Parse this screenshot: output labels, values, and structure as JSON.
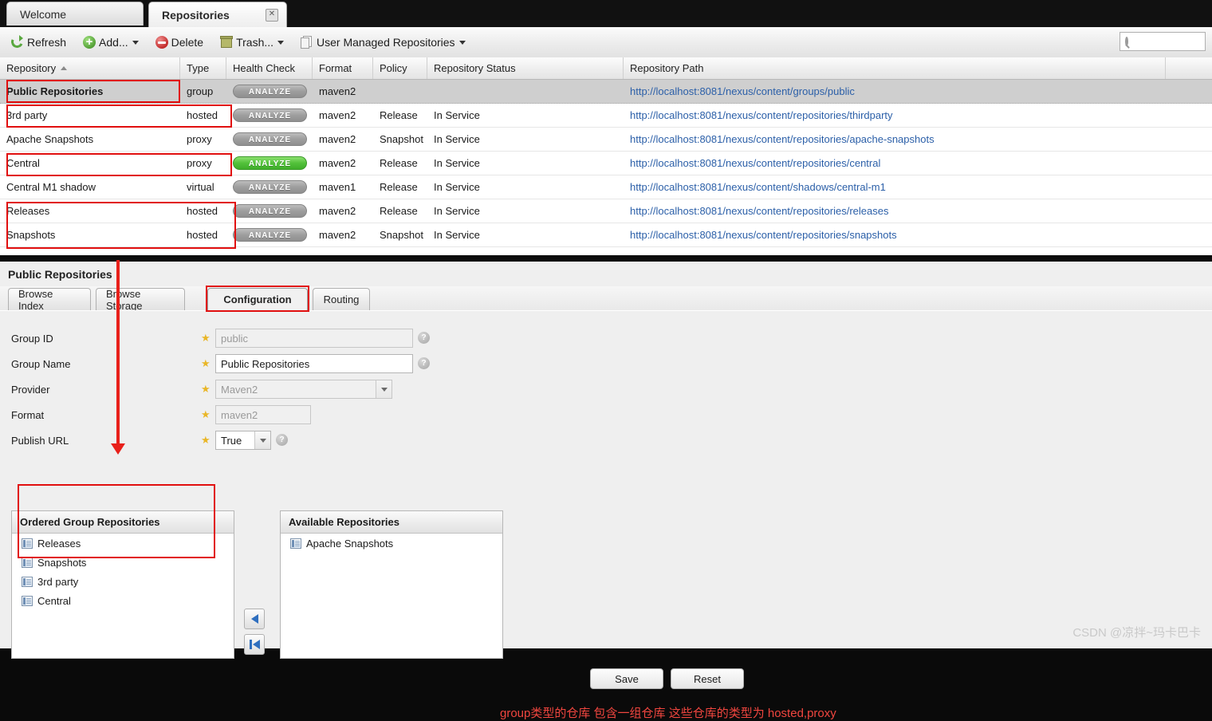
{
  "window": {
    "tabs": [
      {
        "label": "Welcome",
        "active": false,
        "closable": false
      },
      {
        "label": "Repositories",
        "active": true,
        "closable": true,
        "close_icon": "close-icon"
      }
    ]
  },
  "toolbar": {
    "buttons": [
      {
        "label": "Refresh",
        "icon": "refresh-icon",
        "caret": false
      },
      {
        "label": "Add...",
        "icon": "add-icon",
        "caret": true
      },
      {
        "label": "Delete",
        "icon": "delete-icon",
        "caret": false
      },
      {
        "label": "Trash...",
        "icon": "trash-icon",
        "caret": true
      },
      {
        "label": "User Managed Repositories",
        "icon": "copies-icon",
        "caret": true
      }
    ],
    "search": {
      "value": "",
      "placeholder": "",
      "icon": "search-icon"
    }
  },
  "grid": {
    "columns": [
      {
        "label": "Repository",
        "sorted": "asc"
      },
      {
        "label": "Type"
      },
      {
        "label": "Health Check"
      },
      {
        "label": "Format"
      },
      {
        "label": "Policy"
      },
      {
        "label": "Repository Status"
      },
      {
        "label": "Repository Path"
      }
    ],
    "analyze_label": "ANALYZE",
    "rows": [
      {
        "name": "Public Repositories",
        "type": "group",
        "health": "ANALYZE",
        "health_state": "gray",
        "format": "maven2",
        "policy": "",
        "status": "",
        "path": "http://localhost:8081/nexus/content/groups/public",
        "selected": true
      },
      {
        "name": "3rd party",
        "type": "hosted",
        "health": "ANALYZE",
        "health_state": "gray",
        "format": "maven2",
        "policy": "Release",
        "status": "In Service",
        "path": "http://localhost:8081/nexus/content/repositories/thirdparty",
        "selected": false
      },
      {
        "name": "Apache Snapshots",
        "type": "proxy",
        "health": "ANALYZE",
        "health_state": "gray",
        "format": "maven2",
        "policy": "Snapshot",
        "status": "In Service",
        "path": "http://localhost:8081/nexus/content/repositories/apache-snapshots",
        "selected": false
      },
      {
        "name": "Central",
        "type": "proxy",
        "health": "ANALYZE",
        "health_state": "green",
        "format": "maven2",
        "policy": "Release",
        "status": "In Service",
        "path": "http://localhost:8081/nexus/content/repositories/central",
        "selected": false
      },
      {
        "name": "Central M1 shadow",
        "type": "virtual",
        "health": "ANALYZE",
        "health_state": "gray",
        "format": "maven1",
        "policy": "Release",
        "status": "In Service",
        "path": "http://localhost:8081/nexus/content/shadows/central-m1",
        "selected": false
      },
      {
        "name": "Releases",
        "type": "hosted",
        "health": "ANALYZE",
        "health_state": "gray",
        "format": "maven2",
        "policy": "Release",
        "status": "In Service",
        "path": "http://localhost:8081/nexus/content/repositories/releases",
        "selected": false
      },
      {
        "name": "Snapshots",
        "type": "hosted",
        "health": "ANALYZE",
        "health_state": "gray",
        "format": "maven2",
        "policy": "Snapshot",
        "status": "In Service",
        "path": "http://localhost:8081/nexus/content/repositories/snapshots",
        "selected": false
      }
    ]
  },
  "detail": {
    "title": "Public Repositories",
    "tabs": [
      {
        "label": "Browse Index",
        "active": false
      },
      {
        "label": "Browse Storage",
        "active": false
      },
      {
        "label": "Configuration",
        "active": true
      },
      {
        "label": "Routing",
        "active": false
      }
    ],
    "fields": [
      {
        "label": "Group ID",
        "value": "public",
        "kind": "text",
        "disabled": true,
        "required": true,
        "help": true
      },
      {
        "label": "Group Name",
        "value": "Public Repositories",
        "kind": "text",
        "disabled": false,
        "required": true,
        "help": true
      },
      {
        "label": "Provider",
        "value": "Maven2",
        "kind": "select",
        "disabled": true,
        "required": true,
        "help": false
      },
      {
        "label": "Format",
        "value": "maven2",
        "kind": "text",
        "disabled": true,
        "required": true,
        "help": false
      },
      {
        "label": "Publish URL",
        "value": "True",
        "kind": "select",
        "disabled": false,
        "required": true,
        "help": true
      }
    ],
    "ordered_group": {
      "title": "Ordered Group Repositories",
      "items": [
        "Releases",
        "Snapshots",
        "3rd party",
        "Central"
      ]
    },
    "available": {
      "title": "Available Repositories",
      "items": [
        "Apache Snapshots"
      ]
    },
    "transfer": [
      {
        "icon": "arrow-left-icon",
        "name": "move-left-button"
      },
      {
        "icon": "arrow-left-all-icon",
        "name": "move-all-left-button"
      }
    ],
    "actions": [
      {
        "label": "Save"
      },
      {
        "label": "Reset"
      }
    ]
  },
  "annotations": {
    "note": "group类型的仓库  包含一组仓库   这些仓库的类型为 hosted,proxy",
    "accent_color": "#e8201a"
  },
  "watermark": "CSDN @凉拌~玛卡巴卡"
}
